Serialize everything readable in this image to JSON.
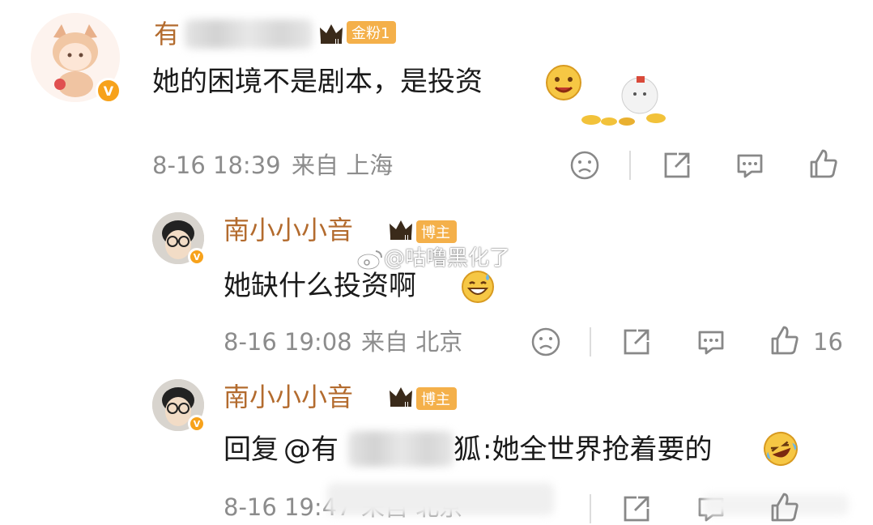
{
  "comments": [
    {
      "username": "有",
      "badge": "金粉1",
      "text": "她的困境不是剧本，是投资",
      "time": "8-16 18:39",
      "source": "来自 上海",
      "likes": ""
    },
    {
      "username": "南小小小音",
      "badge": "博主",
      "text": "她缺什么投资啊",
      "time": "8-16 19:08",
      "source": "来自 北京",
      "likes": "16"
    },
    {
      "username": "南小小小音",
      "badge": "博主",
      "reply_prefix": "回复",
      "reply_at": "@有",
      "reply_at_tail": "狐",
      "text": ":她全世界抢着要的",
      "time": "8-16 19:47",
      "source": "来自 北京"
    }
  ],
  "watermark": "@咕噜黑化了",
  "icons": {
    "dislike": "frown-icon",
    "share": "share-icon",
    "comment": "comment-icon",
    "like": "thumbs-up-icon"
  },
  "colors": {
    "username": "#b36b2e",
    "badge": "#f4b04a",
    "verified": "#f7a21b",
    "meta": "#8c8c8c"
  }
}
